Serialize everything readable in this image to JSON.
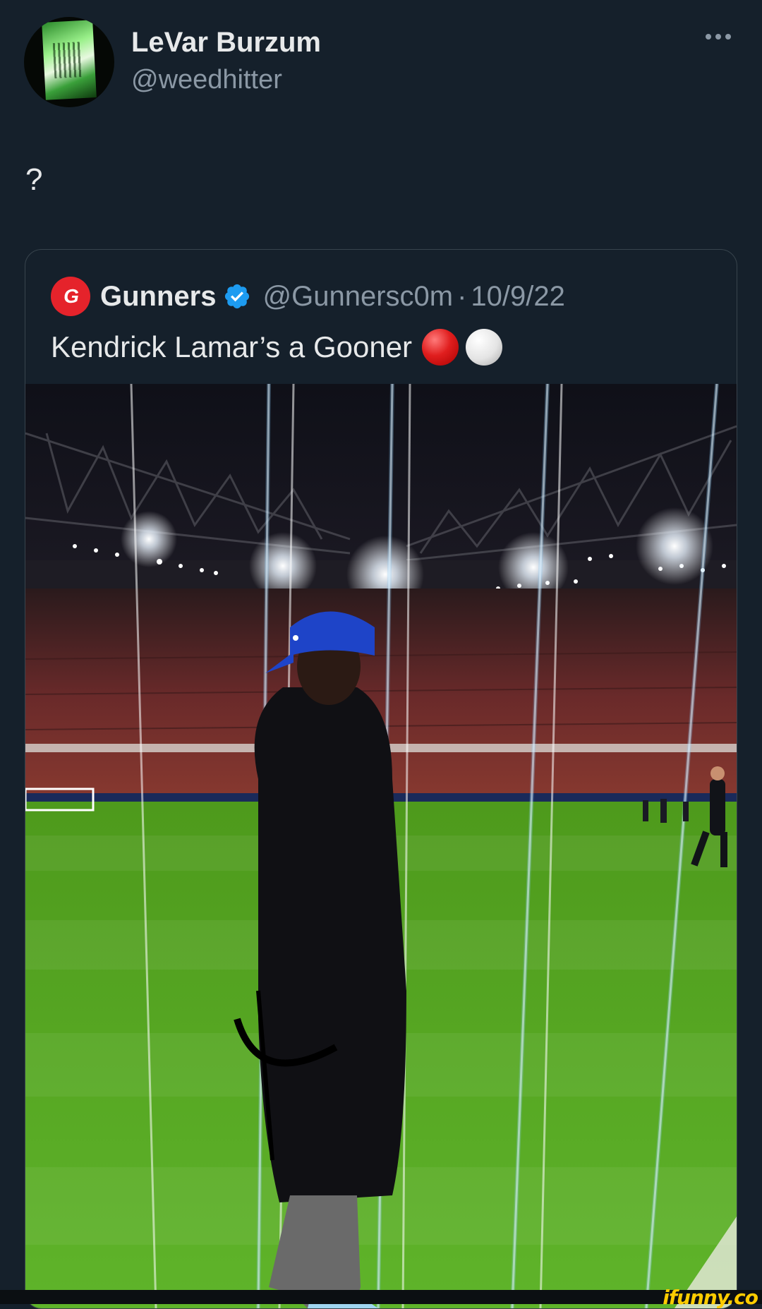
{
  "tweet": {
    "display_name": "LeVar Burzum",
    "handle": "@weedhitter",
    "text": "?",
    "more_icon": "more-dots-icon"
  },
  "quoted_tweet": {
    "display_name": "Gunners",
    "logo_text": "G",
    "handle": "@Gunnersc0m",
    "separator": "·",
    "date": "10/9/22",
    "text": "Kendrick Lamar’s a Gooner",
    "emojis": [
      "red-circle",
      "white-circle"
    ],
    "verified_badge": "verified-badge-icon",
    "brand_color": "#e5232b",
    "verified_color": "#1d9bf0"
  },
  "watermark": {
    "text": "ifunny.co"
  },
  "colors": {
    "background": "#15202b",
    "border": "#38444d",
    "primary_text": "#e7e9ea",
    "secondary_text": "#8b98a5"
  }
}
